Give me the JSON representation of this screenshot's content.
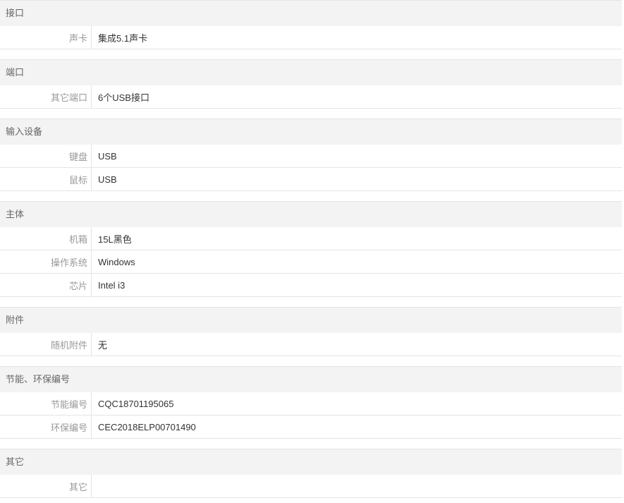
{
  "sections": [
    {
      "title": "接口",
      "rows": [
        {
          "label": "声卡",
          "value": "集成5.1声卡"
        }
      ]
    },
    {
      "title": "端口",
      "rows": [
        {
          "label": "其它端口",
          "value": "6个USB接口"
        }
      ]
    },
    {
      "title": "输入设备",
      "rows": [
        {
          "label": "键盘",
          "value": "USB"
        },
        {
          "label": "鼠标",
          "value": "USB"
        }
      ]
    },
    {
      "title": "主体",
      "rows": [
        {
          "label": "机箱",
          "value": "15L黑色"
        },
        {
          "label": "操作系统",
          "value": "Windows"
        },
        {
          "label": "芯片",
          "value": "Intel i3"
        }
      ]
    },
    {
      "title": "附件",
      "rows": [
        {
          "label": "随机附件",
          "value": "无"
        }
      ]
    },
    {
      "title": "节能、环保编号",
      "rows": [
        {
          "label": "节能编号",
          "value": "CQC18701195065"
        },
        {
          "label": "环保编号",
          "value": "CEC2018ELP00701490"
        }
      ]
    },
    {
      "title": "其它",
      "rows": [
        {
          "label": "其它",
          "value": ""
        }
      ]
    }
  ]
}
